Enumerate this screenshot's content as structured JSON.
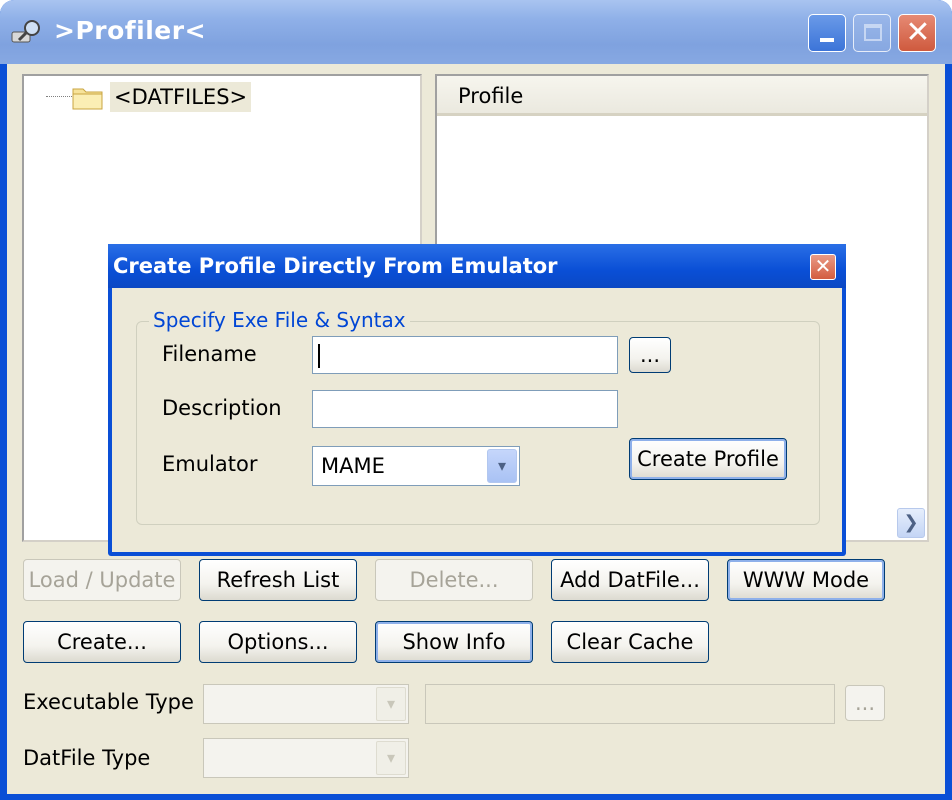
{
  "window": {
    "title": ">Profiler<",
    "close_glyph": "✕"
  },
  "tree": {
    "root_label": "<DATFILES>"
  },
  "profile_list": {
    "column_header": "Profile",
    "scroll_right_glyph": "❯"
  },
  "buttons": {
    "load_update": "Load / Update",
    "refresh_list": "Refresh List",
    "delete": "Delete...",
    "add_datfile": "Add DatFile...",
    "www_mode": "WWW Mode",
    "create": "Create...",
    "options": "Options...",
    "show_info": "Show Info",
    "clear_cache": "Clear Cache",
    "browse_exe": "..."
  },
  "labels": {
    "executable_type": "Executable Type",
    "datfile_type": "DatFile Type"
  },
  "combo_arrow_glyph": "▾",
  "dialog": {
    "title": "Create Profile Directly From Emulator",
    "close_glyph": "✕",
    "group_title": "Specify Exe File & Syntax",
    "filename_label": "Filename",
    "filename_value": "",
    "description_label": "Description",
    "description_value": "",
    "emulator_label": "Emulator",
    "emulator_value": "MAME",
    "browse_label": "...",
    "create_profile_label": "Create Profile"
  },
  "colors": {
    "window_frame": "#0a4fd6",
    "client_bg": "#ece9d8",
    "group_title": "#0046d5"
  }
}
